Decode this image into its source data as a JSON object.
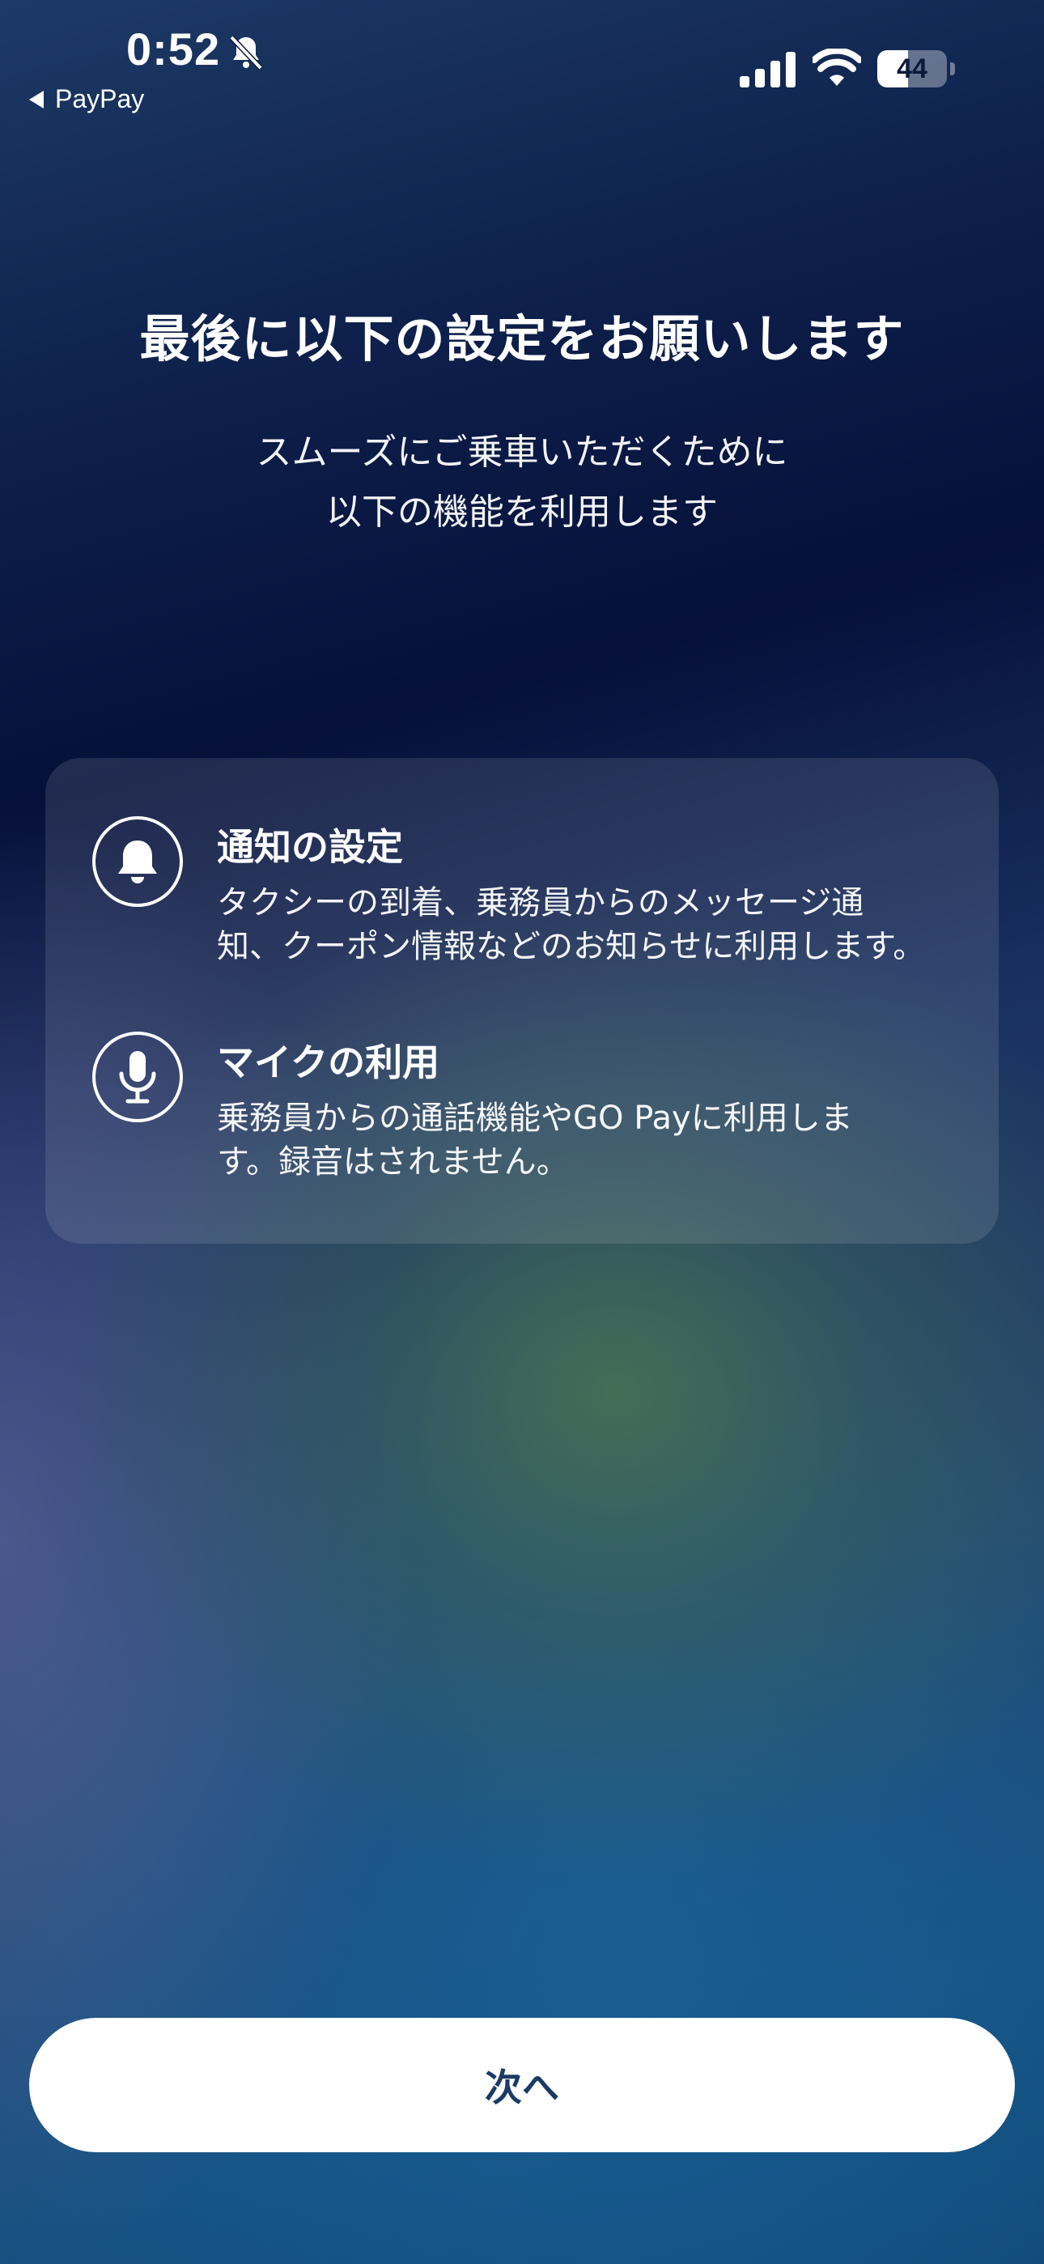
{
  "status_bar": {
    "time": "0:52",
    "back_app_label": "PayPay",
    "battery_level": "44",
    "battery_fraction": 0.44
  },
  "header": {
    "title": "最後に以下の設定をお願いします",
    "subtitle_line1": "スムーズにご乗車いただくために",
    "subtitle_line2": "以下の機能を利用します"
  },
  "permissions": [
    {
      "icon": "bell-icon",
      "title": "通知の設定",
      "desc_line1": "タクシーの到着、乗務員からのメッセージ通",
      "desc_line2": "知、クーポン情報などのお知らせに利用します。"
    },
    {
      "icon": "microphone-icon",
      "title": "マイクの利用",
      "desc_line1": "乗務員からの通話機能やGO Payに利用しま",
      "desc_line2": "す。録音はされません。"
    }
  ],
  "footer": {
    "next_label": "次へ"
  },
  "colors": {
    "button_text": "#1b3a66",
    "button_bg": "#ffffff",
    "card_bg": "rgba(255,255,255,0.11)"
  }
}
